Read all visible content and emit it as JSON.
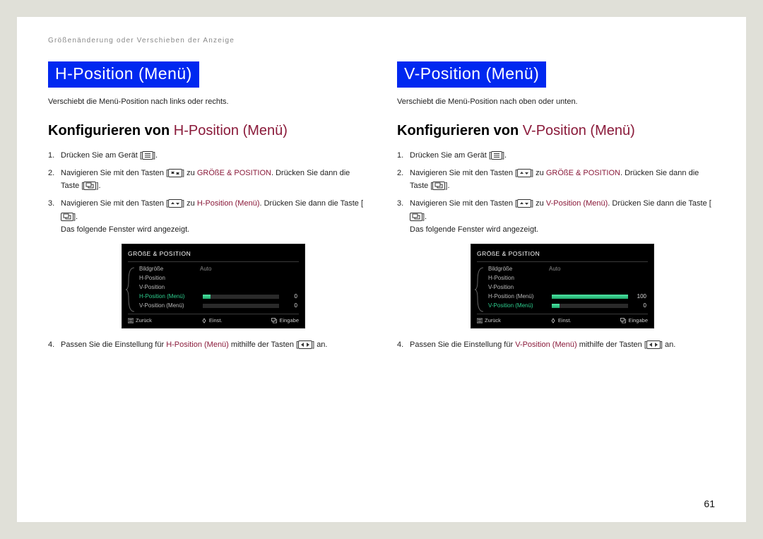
{
  "breadcrumb": "Größenänderung oder Verschieben der Anzeige",
  "page_number": "61",
  "icons": {
    "menu": "menu-icon",
    "updown": "up-down-icon",
    "enter": "enter-icon",
    "leftright": "left-right-icon"
  },
  "left": {
    "title": "H-Position (Menü)",
    "intro": "Verschiebt die Menü-Position nach links oder rechts.",
    "config_prefix": "Konfigurieren von ",
    "config_name": "H-Position (Menü)",
    "step1_a": "Drücken Sie am Gerät [",
    "step1_b": "].",
    "step2_a": "Navigieren Sie mit den Tasten [",
    "step2_b": "] zu ",
    "step2_target": "GRÖßE & POSITION",
    "step2_c": ". Drücken Sie dann die Taste [",
    "step2_d": "].",
    "step3_a": "Navigieren Sie mit den Tasten [",
    "step3_b": "] zu ",
    "step3_target": "H-Position (Menü)",
    "step3_c": ". Drücken Sie dann die Taste [",
    "step3_d": "].",
    "step3_e": "Das folgende Fenster wird angezeigt.",
    "step4_a": "Passen Sie die Einstellung für ",
    "step4_target": "H-Position (Menü)",
    "step4_b": " mithilfe der Tasten [",
    "step4_c": "] an.",
    "osd": {
      "title": "GRÖßE & POSITION",
      "rows": [
        {
          "label": "Bildgröße",
          "value": "Auto"
        },
        {
          "label": "H-Position"
        },
        {
          "label": "V-Position"
        },
        {
          "label": "H-Position (Menü)",
          "selected": true,
          "slider": 10,
          "num": "0"
        },
        {
          "label": "V-Position (Menü)",
          "slider": 0,
          "num": "0"
        }
      ],
      "footer": {
        "back": "Zurück",
        "adjust": "Einst.",
        "enter": "Eingabe"
      }
    }
  },
  "right": {
    "title": "V-Position (Menü)",
    "intro": "Verschiebt die Menü-Position nach oben oder unten.",
    "config_prefix": "Konfigurieren von ",
    "config_name": "V-Position (Menü)",
    "step1_a": "Drücken Sie am Gerät [",
    "step1_b": "].",
    "step2_a": "Navigieren Sie mit den Tasten [",
    "step2_b": "] zu ",
    "step2_target": "GRÖßE & POSITION",
    "step2_c": ". Drücken Sie dann die Taste [",
    "step2_d": "].",
    "step3_a": "Navigieren Sie mit den Tasten [",
    "step3_b": "] zu ",
    "step3_target": "V-Position (Menü)",
    "step3_c": ". Drücken Sie dann die Taste [",
    "step3_d": "].",
    "step3_e": "Das folgende Fenster wird angezeigt.",
    "step4_a": "Passen Sie die Einstellung für ",
    "step4_target": "V-Position (Menü)",
    "step4_b": " mithilfe der Tasten [",
    "step4_c": "] an.",
    "osd": {
      "title": "GRÖßE & POSITION",
      "rows": [
        {
          "label": "Bildgröße",
          "value": "Auto"
        },
        {
          "label": "H-Position"
        },
        {
          "label": "V-Position"
        },
        {
          "label": "H-Position (Menü)",
          "slider": 100,
          "num": "100"
        },
        {
          "label": "V-Position (Menü)",
          "selected": true,
          "slider": 10,
          "num": "0"
        }
      ],
      "footer": {
        "back": "Zurück",
        "adjust": "Einst.",
        "enter": "Eingabe"
      }
    }
  }
}
